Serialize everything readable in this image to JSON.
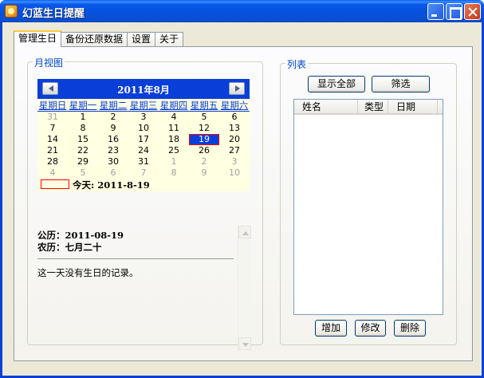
{
  "window": {
    "title": "幻蓝生日提醒"
  },
  "tabs": [
    {
      "label": "管理生日",
      "active": true
    },
    {
      "label": "备份还原数据",
      "active": false
    },
    {
      "label": "设置",
      "active": false
    },
    {
      "label": "关于",
      "active": false
    }
  ],
  "month_view": {
    "label": "月视图",
    "calendar": {
      "month_label": "2011年8月",
      "weekdays": [
        "星期日",
        "星期一",
        "星期二",
        "星期三",
        "星期四",
        "星期五",
        "星期六"
      ],
      "weeks": [
        [
          "31",
          "1",
          "2",
          "3",
          "4",
          "5",
          "6"
        ],
        [
          "7",
          "8",
          "9",
          "10",
          "11",
          "12",
          "13"
        ],
        [
          "14",
          "15",
          "16",
          "17",
          "18",
          "19",
          "20"
        ],
        [
          "21",
          "22",
          "23",
          "24",
          "25",
          "26",
          "27"
        ],
        [
          "28",
          "29",
          "30",
          "31",
          "1",
          "2",
          "3"
        ],
        [
          "4",
          "5",
          "6",
          "7",
          "8",
          "9",
          "10"
        ]
      ],
      "other_month_cells": [
        "0-0",
        "4-4",
        "4-5",
        "4-6",
        "5-0",
        "5-1",
        "5-2",
        "5-3",
        "5-4",
        "5-5",
        "5-6"
      ],
      "selected_cell": "2-5",
      "today_text": "今天: 2011-8-19",
      "selected_color": "#0a3ed8",
      "today_marker_color": "#ff0000"
    },
    "info": {
      "solar": "公历：2011-08-19",
      "lunar": "农历：七月二十",
      "note": "这一天没有生日的记录。"
    }
  },
  "list_panel": {
    "label": "列表",
    "show_all_label": "显示全部",
    "filter_label": "筛选",
    "columns": [
      "姓名",
      "类型",
      "日期"
    ],
    "rows": [],
    "add_label": "增加",
    "edit_label": "修改",
    "delete_label": "删除"
  }
}
